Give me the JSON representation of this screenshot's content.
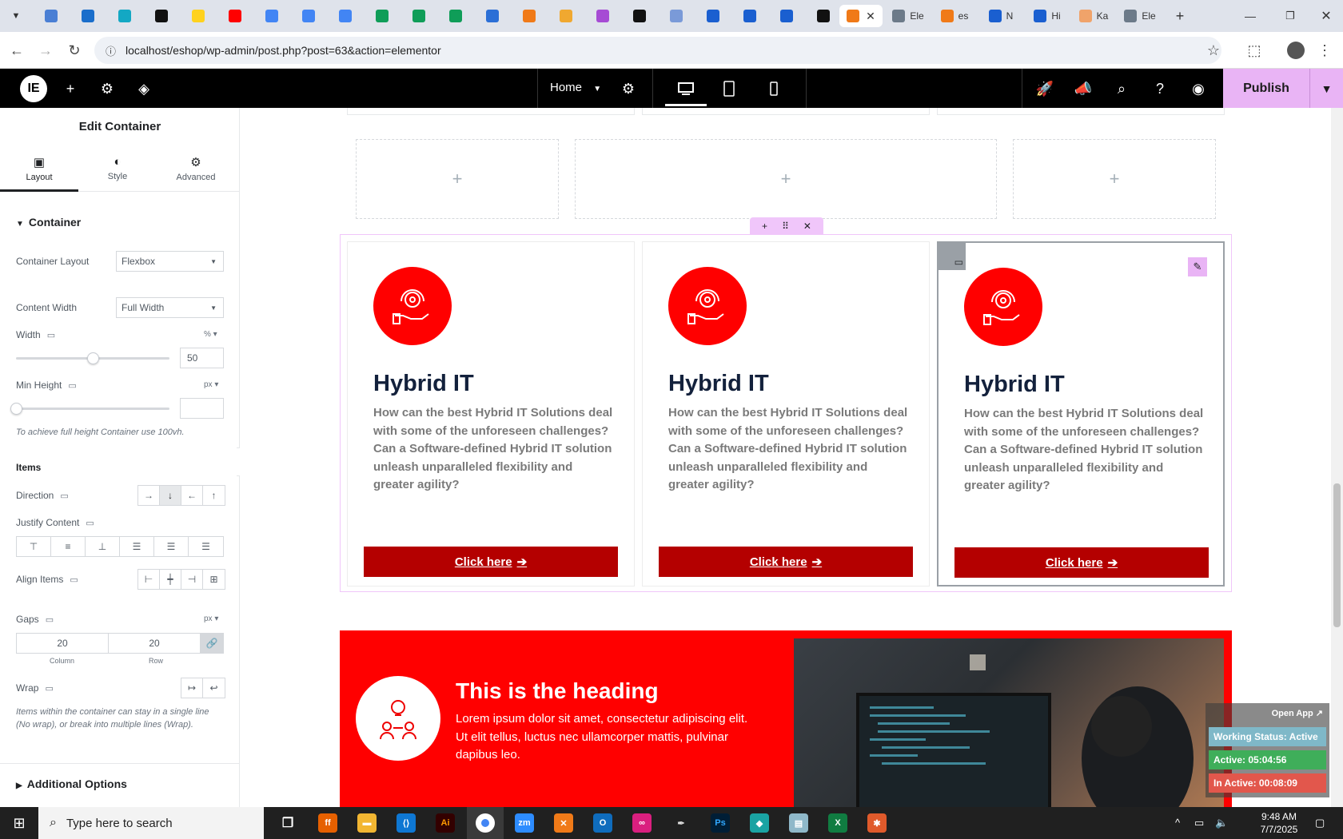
{
  "browser": {
    "url": "localhost/eshop/wp-admin/post.php?post=63&action=elementor",
    "tabs": [
      {
        "label": "",
        "color": "#4a7fd4"
      },
      {
        "label": "",
        "color": "#1a6ecb"
      },
      {
        "label": "",
        "color": "#13a8c4"
      },
      {
        "label": "",
        "color": "#111111"
      },
      {
        "label": "",
        "color": "#ffd21e"
      },
      {
        "label": "",
        "color": "#ff0000"
      },
      {
        "label": "",
        "color": "#4285f4"
      },
      {
        "label": "",
        "color": "#4285f4"
      },
      {
        "label": "",
        "color": "#4285f4"
      },
      {
        "label": "",
        "color": "#0f9d58"
      },
      {
        "label": "",
        "color": "#0f9d58"
      },
      {
        "label": "",
        "color": "#0f9d58"
      },
      {
        "label": "",
        "color": "#2b6fd6"
      },
      {
        "label": "",
        "color": "#f07a18"
      },
      {
        "label": "",
        "color": "#f0a830"
      },
      {
        "label": "",
        "color": "#a64bd4"
      },
      {
        "label": "",
        "color": "#111111"
      },
      {
        "label": "",
        "color": "#7a9ad8"
      },
      {
        "label": "",
        "color": "#1a5fd0"
      },
      {
        "label": "",
        "color": "#1a5fd0"
      },
      {
        "label": "",
        "color": "#1a5fd0"
      },
      {
        "label": "",
        "color": "#111111"
      }
    ],
    "active_tab": {
      "label": "",
      "color": "#f07a18"
    },
    "right_tabs": [
      {
        "label": "Ele",
        "color": "#6c7a89"
      },
      {
        "label": "es",
        "color": "#f07a18"
      },
      {
        "label": "N",
        "color": "#1a5fd0"
      },
      {
        "label": "Hi",
        "color": "#1a5fd0"
      },
      {
        "label": "Ka",
        "color": "#f0a36a"
      },
      {
        "label": "Ele",
        "color": "#6c7a89"
      }
    ]
  },
  "editor": {
    "page_name": "Home",
    "publish_label": "Publish"
  },
  "panel": {
    "title": "Edit Container",
    "tabs": [
      {
        "label": "Layout",
        "icon": "layout-icon"
      },
      {
        "label": "Style",
        "icon": "style-icon"
      },
      {
        "label": "Advanced",
        "icon": "gear-icon"
      }
    ],
    "section_container": "Container",
    "container_layout": {
      "label": "Container Layout",
      "value": "Flexbox"
    },
    "content_width": {
      "label": "Content Width",
      "value": "Full Width"
    },
    "width": {
      "label": "Width",
      "unit": "%",
      "value": "50",
      "fraction": 0.5
    },
    "min_height": {
      "label": "Min Height",
      "unit": "px",
      "value": "",
      "fraction": 0
    },
    "min_height_hint": "To achieve full height Container use 100vh.",
    "items_heading": "Items",
    "direction_label": "Direction",
    "justify_label": "Justify Content",
    "align_label": "Align Items",
    "gaps": {
      "label": "Gaps",
      "unit": "px",
      "column": "20",
      "row": "20",
      "column_label": "Column",
      "row_label": "Row"
    },
    "wrap_label": "Wrap",
    "wrap_hint": "Items within the container can stay in a single line (No wrap), or break into multiple lines (Wrap).",
    "additional_options": "Additional Options"
  },
  "cards": [
    {
      "title": "Hybrid IT",
      "text": "How can the best Hybrid IT Solutions deal with some of the unforeseen challenges? Can a Software-defined Hybrid IT solution unleash unparalleled flexibility and greater agility?",
      "button": "Click here"
    },
    {
      "title": "Hybrid IT",
      "text": "How can the best Hybrid IT Solutions deal with some of the unforeseen challenges? Can a Software-defined Hybrid IT solution unleash unparalleled flexibility and greater agility?",
      "button": "Click here"
    },
    {
      "title": "Hybrid IT",
      "text": "How can the best Hybrid IT Solutions deal with some of the unforeseen challenges? Can a Software-defined Hybrid IT solution unleash unparalleled flexibility and greater agility?",
      "button": "Click here"
    }
  ],
  "feature": {
    "heading": "This is the heading",
    "text": "Lorem ipsum dolor sit amet, consectetur adipiscing elit. Ut elit tellus, luctus nec ullamcorper mattis, pulvinar dapibus leo."
  },
  "widget": {
    "open_app": "Open App ↗",
    "status": "Working Status: Active",
    "active": "Active: 05:04:56",
    "inactive": "In Active: 00:08:09",
    "colors": {
      "status": "#7fb8c8",
      "active": "#3fae5a",
      "inactive": "#e2574c"
    }
  },
  "taskbar": {
    "search_placeholder": "Type here to search",
    "time": "9:48 AM",
    "date": "7/7/2025"
  },
  "colors": {
    "accent_red": "#ff0000",
    "button_red": "#b40000",
    "publish_pink": "#e9b4f5",
    "heading_navy": "#13213c"
  }
}
